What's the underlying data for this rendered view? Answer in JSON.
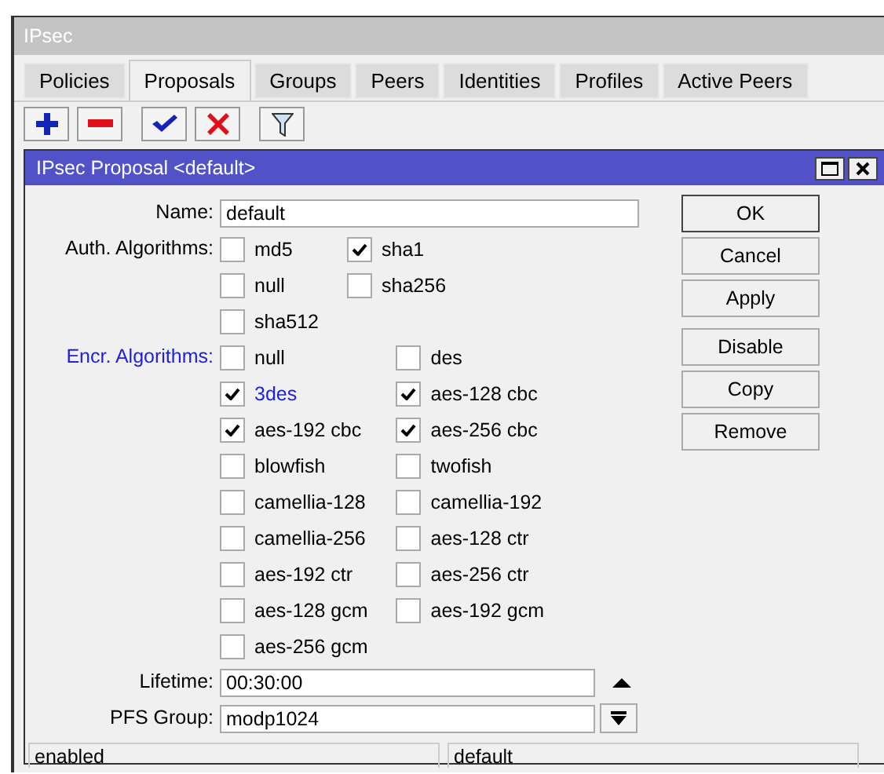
{
  "window": {
    "title": "IPsec"
  },
  "tabs": [
    {
      "label": "Policies",
      "selected": false
    },
    {
      "label": "Proposals",
      "selected": true
    },
    {
      "label": "Groups",
      "selected": false
    },
    {
      "label": "Peers",
      "selected": false
    },
    {
      "label": "Identities",
      "selected": false
    },
    {
      "label": "Profiles",
      "selected": false
    },
    {
      "label": "Active Peers",
      "selected": false
    }
  ],
  "toolbar": [
    {
      "kind": "add"
    },
    {
      "kind": "remove"
    },
    {
      "kind": "enable"
    },
    {
      "kind": "disable"
    },
    {
      "kind": "filter"
    }
  ],
  "dialog": {
    "title": "IPsec Proposal <default>",
    "name": {
      "label": "Name:",
      "value": "default"
    },
    "groups": [
      {
        "label": "Auth. Algorithms:",
        "highlighted": false,
        "options": [
          {
            "label": "md5",
            "checked": false,
            "highlighted": false
          },
          {
            "label": "sha1",
            "checked": true,
            "highlighted": false
          },
          {
            "label": "null",
            "checked": false,
            "highlighted": false
          },
          {
            "label": "sha256",
            "checked": false,
            "highlighted": false
          },
          {
            "label": "sha512",
            "checked": false,
            "highlighted": false
          }
        ]
      },
      {
        "label": "Encr. Algorithms:",
        "highlighted": true,
        "options": [
          {
            "label": "null",
            "checked": false,
            "highlighted": false
          },
          {
            "label": "des",
            "checked": false,
            "highlighted": false
          },
          {
            "label": "3des",
            "checked": true,
            "highlighted": true
          },
          {
            "label": "aes-128 cbc",
            "checked": true,
            "highlighted": false
          },
          {
            "label": "aes-192 cbc",
            "checked": true,
            "highlighted": false
          },
          {
            "label": "aes-256 cbc",
            "checked": true,
            "highlighted": false
          },
          {
            "label": "blowfish",
            "checked": false,
            "highlighted": false
          },
          {
            "label": "twofish",
            "checked": false,
            "highlighted": false
          },
          {
            "label": "camellia-128",
            "checked": false,
            "highlighted": false
          },
          {
            "label": "camellia-192",
            "checked": false,
            "highlighted": false
          },
          {
            "label": "camellia-256",
            "checked": false,
            "highlighted": false
          },
          {
            "label": "aes-128 ctr",
            "checked": false,
            "highlighted": false
          },
          {
            "label": "aes-192 ctr",
            "checked": false,
            "highlighted": false
          },
          {
            "label": "aes-256 ctr",
            "checked": false,
            "highlighted": false
          },
          {
            "label": "aes-128 gcm",
            "checked": false,
            "highlighted": false
          },
          {
            "label": "aes-192 gcm",
            "checked": false,
            "highlighted": false
          },
          {
            "label": "aes-256 gcm",
            "checked": false,
            "highlighted": false
          }
        ]
      }
    ],
    "lifetime": {
      "label": "Lifetime:",
      "value": "00:30:00"
    },
    "pfs_group": {
      "label": "PFS Group:",
      "value": "modp1024"
    },
    "buttons": [
      {
        "label": "OK",
        "default": true
      },
      {
        "label": "Cancel",
        "default": false
      },
      {
        "label": "Apply",
        "default": false
      },
      {
        "label": "Disable",
        "default": false
      },
      {
        "label": "Copy",
        "default": false
      },
      {
        "label": "Remove",
        "default": false
      }
    ],
    "status_bar": [
      "enabled",
      "default"
    ]
  }
}
